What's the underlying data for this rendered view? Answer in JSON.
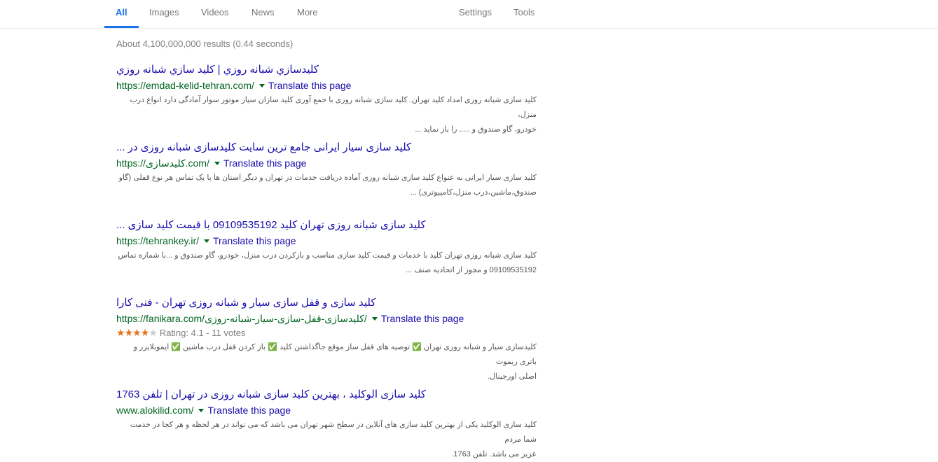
{
  "tabs": {
    "all": "All",
    "images": "Images",
    "videos": "Videos",
    "news": "News",
    "more": "More",
    "settings": "Settings",
    "tools": "Tools"
  },
  "stats": "About 4,100,000,000 results (0.44 seconds)",
  "accent_color": "#1a73e8",
  "results": [
    {
      "title": "كليدسازي شبانه روزي | كليد سازي شبانه روزي",
      "url": "https://emdad-kelid-tehran.com/",
      "translate": "Translate this page",
      "snippet_1": "کلید سازی شبانه روزی امداد کلید تهران. کلید سازی شبانه روزی با جمع آوری کلید سازان سیار موتور سوار آمادگی دارد انواع درب منزل،",
      "snippet_2": "خودرو، گاو صندوق و ..... را باز نماید ..."
    },
    {
      "title": "کلید سازی سیار ایرانی جامع ترین سایت کلیدسازی شبانه روزی در ...",
      "url": "https://کلیدسازی.com/",
      "translate": "Translate this page",
      "snippet_1": "کلید سازی سیار ایرانی به عنواع کلید سازی شبانه روزی آماده دریافت خدمات در تهران و دیگر استان ها با یک تماس هر نوع قفلی (گاو",
      "snippet_2": "صندوق،ماشین،درب منزل،کامپیوتری) ..."
    },
    {
      "title": "کلید سازی شبانه روزی تهران کلید 09109535192 با قیمت کلید سازی ...",
      "url": "https://tehrankey.ir/",
      "translate": "Translate this page",
      "snippet_1": "کلید سازی شبانه روزی تهران کلید با خدمات و قیمت کلید سازی مناسب و بازکردن درب منزل، خودرو، گاو صندوق و ...با شماره تماس",
      "snippet_2": "09109535192 و مجوز از اتحادیه صنف ..."
    },
    {
      "title": "کلید سازی و قفل سازی سیار و شبانه روزی تهران - فنی کارا",
      "url": "https://fanikara.com/کلیدسازی-قفل-سازی-سیار-شبانه-روزی/",
      "translate": "Translate this page",
      "rating": "Rating: 4.1 - 11 votes",
      "rating_value": 4.1,
      "rating_max": 5,
      "snippet_1": "کلیدسازی سیار و شبانه روزی تهران ✅ توصیه های قفل ساز موقع جاگذاشتن کلید ✅ باز کردن قفل درب ماشین ✅ ایموبلایزر و باتری ریموت",
      "snippet_2": "اصلی اورجینال."
    },
    {
      "title": "کلید سازی الوکلید ، بهترین کلید سازی شبانه روزی در تهران | تلفن 1763",
      "url": "www.alokilid.com/",
      "translate": "Translate this page",
      "snippet_1": "کلید سازی الوکلید یکی از بهترین کلید سازی های آنلاین در سطح شهر تهران می باشد که می تواند در هر لحظه و هر کجا در خدمت شما مردم",
      "snippet_2": "عزیز می باشد. تلفن 1763."
    }
  ]
}
